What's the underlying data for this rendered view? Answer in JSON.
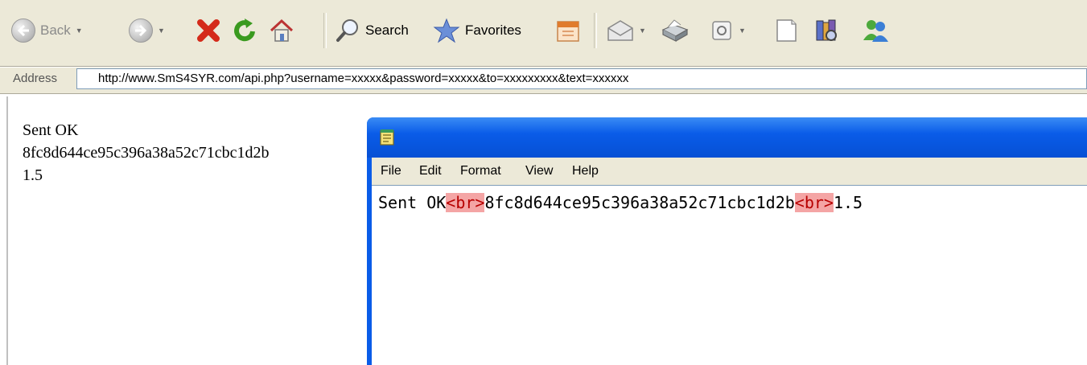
{
  "toolbar": {
    "back_label": "Back",
    "search_label": "Search",
    "favorites_label": "Favorites"
  },
  "address": {
    "label": "Address",
    "url": "http://www.SmS4SYR.com/api.php?username=xxxxx&password=xxxxx&to=xxxxxxxxx&text=xxxxxx"
  },
  "page": {
    "line1": "Sent OK",
    "line2": "8fc8d644ce95c396a38a52c71cbc1d2b",
    "line3": "1.5"
  },
  "notepad": {
    "menu": [
      "File",
      "Edit",
      "Format",
      "View",
      "Help"
    ],
    "text_sent": "Sent OK",
    "br1": "<br>",
    "text_hash": "8fc8d644ce95c396a38a52c71cbc1d2b",
    "br2": "<br>",
    "text_value": "1.5"
  },
  "colors": {
    "chrome": "#ece9d8",
    "titlebar": "#0a5ce8",
    "highlight": "#f4a5a5"
  }
}
